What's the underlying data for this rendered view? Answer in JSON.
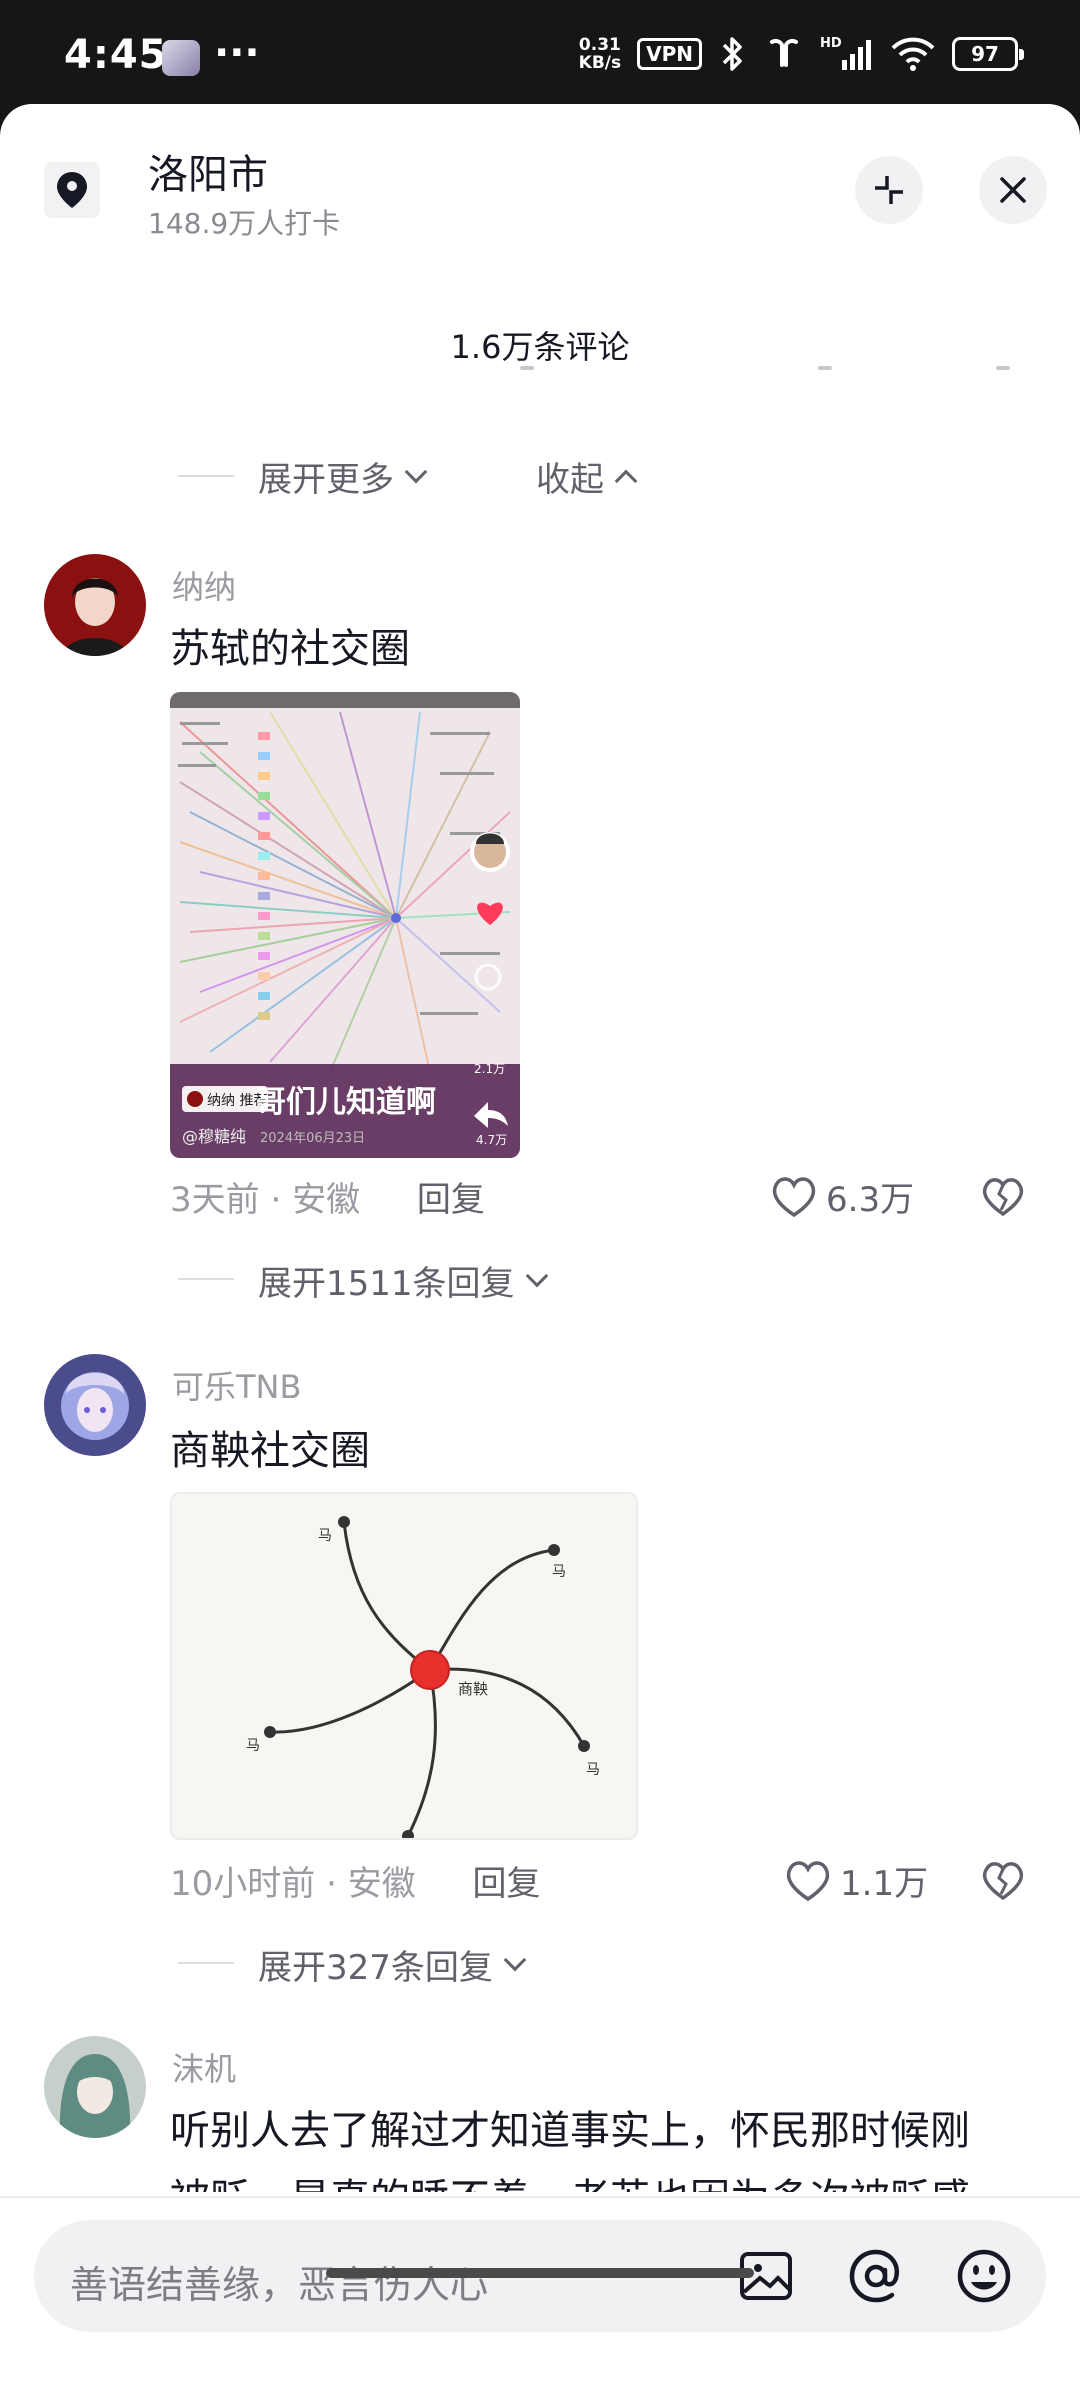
{
  "status_bar": {
    "time": "4:45",
    "dots": "···",
    "net_speed_value": "0.31",
    "net_speed_unit": "KB/s",
    "vpn": "VPN",
    "battery": "97"
  },
  "location": {
    "title": "洛阳市",
    "checkins": "148.9万人打卡"
  },
  "comment_count": "1.6万条评论",
  "thread_controls": {
    "expand_more": "展开更多",
    "collapse": "收起"
  },
  "comments": [
    {
      "username": "纳纳",
      "text": "苏轼的社交圈",
      "image": {
        "caption": "哥们儿知道啊",
        "badge": "纳纳 推荐",
        "author": "@穆糖纯",
        "date": "2024年06月23日",
        "likes": "2.1万",
        "shares": "4.7万"
      },
      "time": "3天前",
      "region": "安徽",
      "reply_label": "回复",
      "likes": "6.3万",
      "expand_replies": "展开1511条回复"
    },
    {
      "username": "可乐TNB",
      "text": "商鞅社交圈",
      "image": {
        "center_label": "商鞅",
        "node_label": "马"
      },
      "time": "10小时前",
      "region": "安徽",
      "reply_label": "回复",
      "likes": "1.1万",
      "expand_replies": "展开327条回复"
    },
    {
      "username": "沫机",
      "text": "听别人去了解过才知道事实上，怀民那时候刚",
      "text_line2": "被贬，是真的睡不着，老苏也因为多次被贬感"
    }
  ],
  "input": {
    "placeholder": "善语结善缘，恶言伤人心"
  },
  "icons": {
    "location": "location-pin-icon",
    "shrink": "shrink-icon",
    "close": "close-icon",
    "like": "heart-icon",
    "dislike": "broken-heart-icon",
    "image": "image-icon",
    "mention": "at-icon",
    "emoji": "emoji-icon"
  },
  "colors": {
    "accent_heart": "#ff3b5c",
    "text_primary": "#161823",
    "text_secondary": "#9a9ba1"
  }
}
